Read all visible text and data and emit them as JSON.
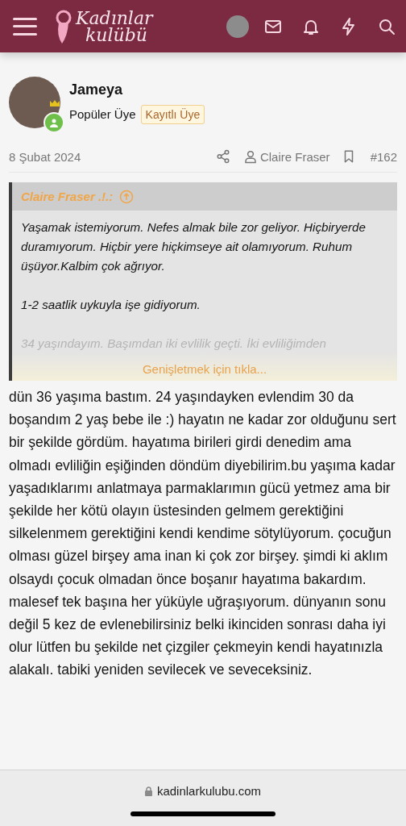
{
  "header": {
    "logo": [
      "Kadınlar",
      "kulübü"
    ]
  },
  "post": {
    "author": "Jameya",
    "rank": "Popüler Üye",
    "badge": "Kayıtlı Üye",
    "online": true,
    "date": "8 Şubat 2024",
    "reply_to": "Claire Fraser",
    "number": "#162",
    "quote": {
      "source": "Claire Fraser .!.:",
      "paragraphs": [
        "Yaşamak istemiyorum. Nefes almak bile zor geliyor. Hiçbiryerde duramıyorum. Hiçbir yere hiçkimseye ait olamıyorum. Ruhum üşüyor.Kalbim çok ağrıyor.",
        "1-2 saatlik uykuyla işe gidiyorum.",
        "34 yaşındayım. Başımdan iki evlilik geçti. İki evliliğimden"
      ],
      "expand": "Genişletmek için tıkla..."
    },
    "body": "dün 36 yaşıma bastım. 24 yaşındayken evlendim 30 da boşandım 2 yaş bebe ile :) hayatın ne kadar zor olduğunu sert bir şekilde gördüm. hayatıma birileri girdi denedim ama olmadı evliliğin eşiğinden döndüm diyebilirim.bu yaşıma kadar yaşadıklarımı anlatmaya parmaklarımın gücü yetmez ama bir şekilde her kötü olayın üstesinden gelmem gerektiğini silkelenmem gerektiğini kendi kendime sötylüyorum. çocuğun olması güzel birşey ama inan ki çok zor birşey. şimdi ki aklım olsaydı çocuk olmadan önce boşanır hayatıma bakardım. malesef tek başına her yüküyle uğraşıyorum. dünyanın sonu değil 5 kez de evlenebilirsiniz belki ikinciden sonrası daha iyi olur lütfen bu şekilde net çizgiler çekmeyin kendi hayatınızla alakalı. tabiki yeniden sevilecek ve seveceksiniz."
  },
  "browser": {
    "url": "kadinlarkulubu.com"
  }
}
